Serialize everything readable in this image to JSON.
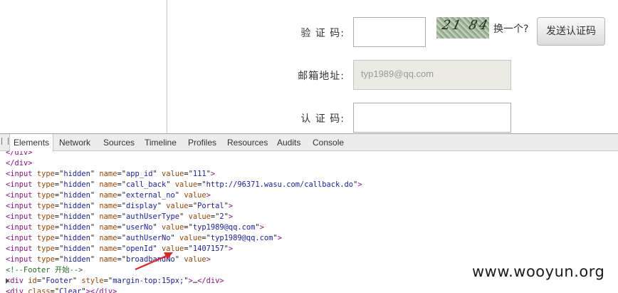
{
  "form": {
    "captcha_label": "验 证 码:",
    "captcha_value": "",
    "captcha_image_text": "21 84",
    "change_link": "换一个?",
    "send_button": "发送认证码",
    "email_label": "邮箱地址:",
    "email_value": "typ1989@qq.com",
    "verify_label": "认 证 码:",
    "verify_value": ""
  },
  "devtools": {
    "tabs": [
      "Elements",
      "Network",
      "Sources",
      "Timeline",
      "Profiles",
      "Resources",
      "Audits",
      "Console"
    ],
    "active_tab": "Elements",
    "lines": [
      {
        "kind": "close",
        "text": "</div>"
      },
      {
        "kind": "close",
        "text": "</div>"
      },
      {
        "kind": "input",
        "type": "hidden",
        "name": "app_id",
        "value": "111"
      },
      {
        "kind": "input",
        "type": "hidden",
        "name": "call_back",
        "value": "http://96371.wasu.com/callback.do"
      },
      {
        "kind": "input_novalue",
        "type": "hidden",
        "name": "external_no"
      },
      {
        "kind": "input",
        "type": "hidden",
        "name": "display",
        "value": "Portal"
      },
      {
        "kind": "input",
        "type": "hidden",
        "name": "authUserType",
        "value": "2"
      },
      {
        "kind": "input",
        "type": "hidden",
        "name": "userNo",
        "value": "typ1989@qq.com"
      },
      {
        "kind": "input",
        "type": "hidden",
        "name": "authUserNo",
        "value": "typ1989@qq.com"
      },
      {
        "kind": "input",
        "type": "hidden",
        "name": "openId",
        "value": "1407157"
      },
      {
        "kind": "input_novalue",
        "type": "hidden",
        "name": "broadbandNo"
      },
      {
        "kind": "comment",
        "text": "<!--Footer 开始-->"
      },
      {
        "kind": "div_footer",
        "id": "Footer",
        "style": "margin-top:15px;",
        "ellipsis": "…"
      },
      {
        "kind": "div_clear",
        "class": "Clear"
      }
    ]
  },
  "watermark": "www.wooyun.org",
  "colors": {
    "tag": "#881280",
    "attr": "#994500",
    "value": "#1a1aa6",
    "comment": "#236e25",
    "arrow": "#e0261f"
  }
}
